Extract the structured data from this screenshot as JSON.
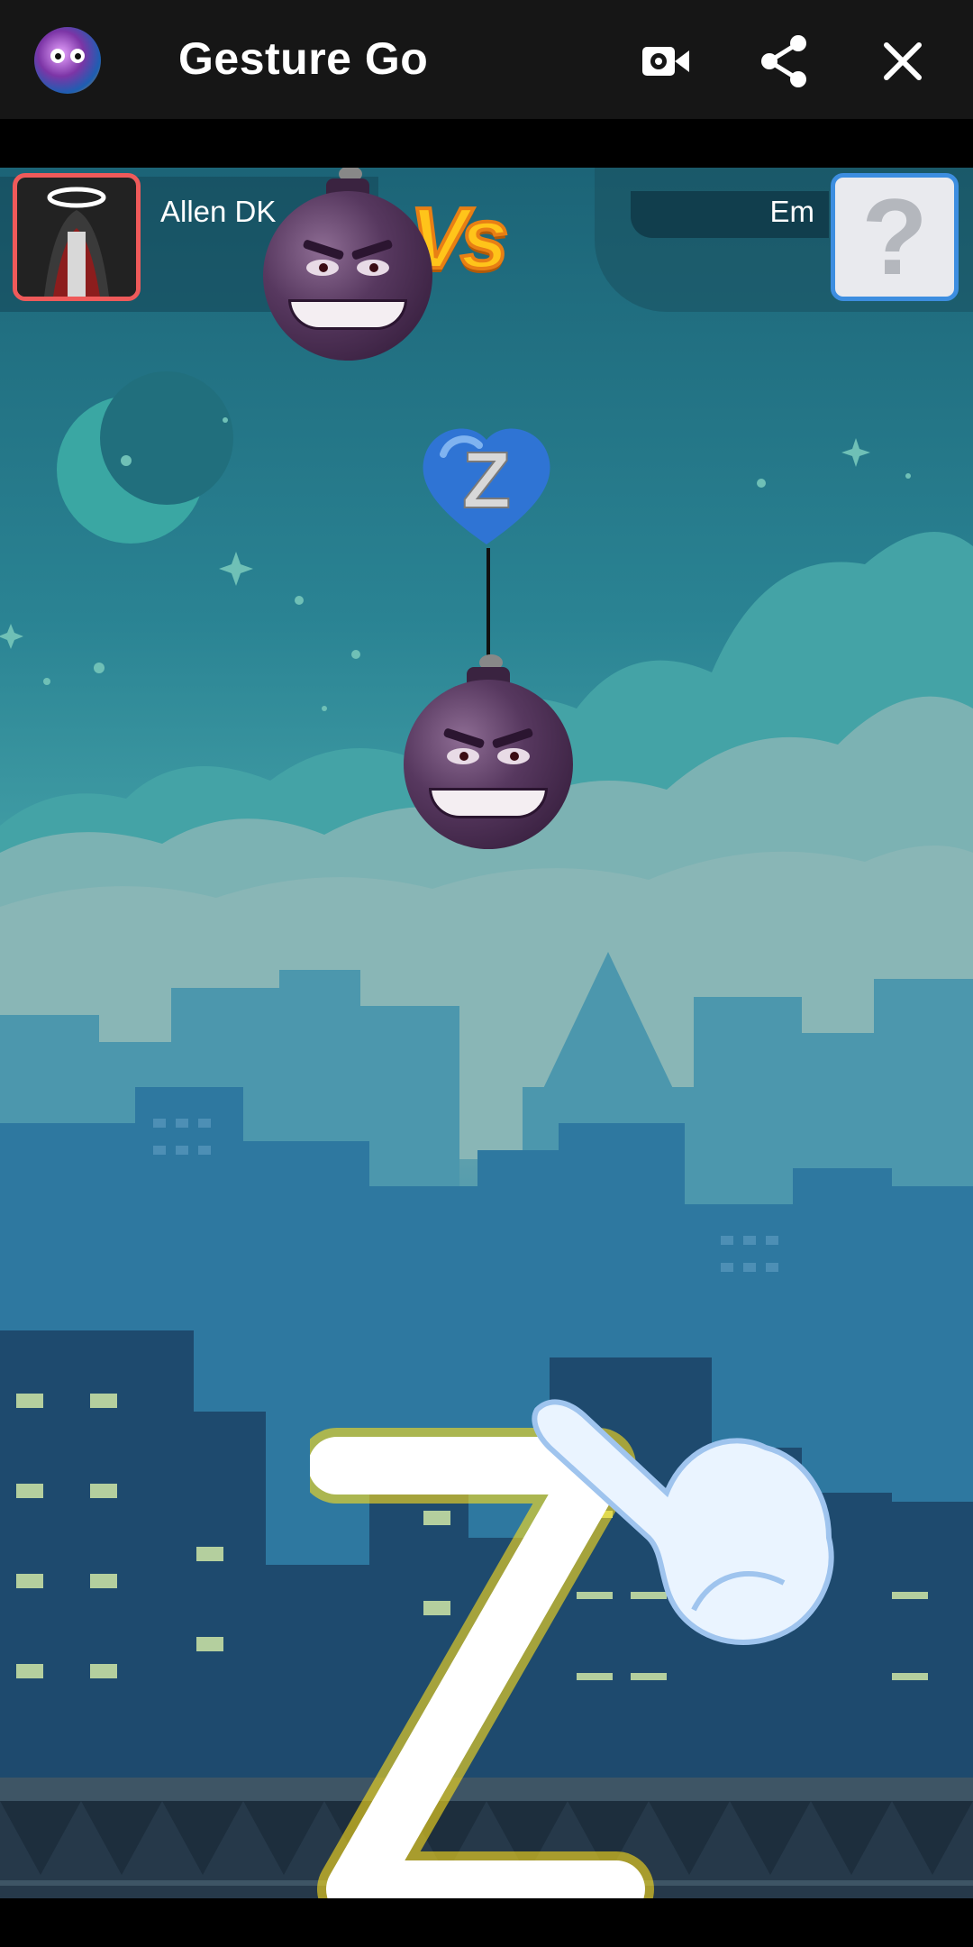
{
  "app": {
    "title": "Gesture Go",
    "icons": [
      "app-icon",
      "record-icon",
      "share-icon",
      "close-icon"
    ]
  },
  "players": {
    "left": {
      "name": "Allen DK",
      "border_color": "#ef5a5a"
    },
    "right": {
      "name": "Em",
      "avatar_placeholder": "?",
      "border_color": "#3d8ee0"
    }
  },
  "vs_label": "Vs",
  "balloon": {
    "letter": "Z",
    "color": "#2f74d4"
  },
  "gesture": {
    "letter": "Z",
    "glow_color": "#ffe01a"
  },
  "colors": {
    "sky_top": "#1c6477",
    "city": "#1e4f72",
    "bomb": "#57385f"
  }
}
